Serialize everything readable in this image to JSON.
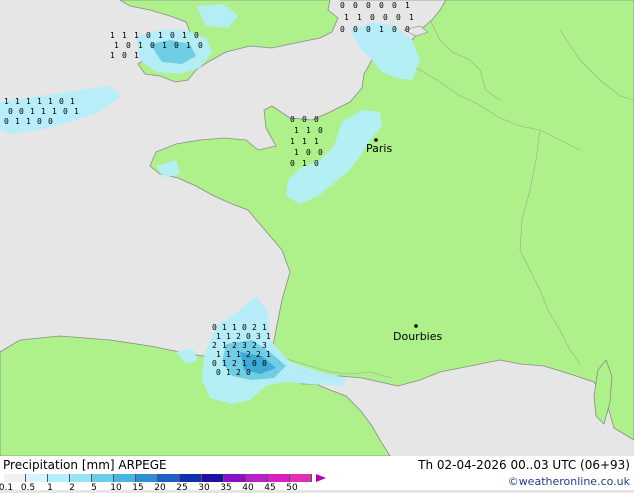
{
  "map": {
    "colors": {
      "land": "#aef08a",
      "sea": "#e6e6e6",
      "coast": "#8a8a8a",
      "precip_light": "#b4eefa",
      "precip_mid": "#6ccde8",
      "precip_heavy": "#38a8d8"
    },
    "cities": [
      {
        "name": "Paris"
      },
      {
        "name": "Dourbies"
      }
    ],
    "grid_values": {
      "channel": [
        "1",
        "1",
        "1",
        "0",
        "1",
        "0",
        "1",
        "0",
        "1",
        "0",
        "1",
        "0",
        "1",
        "0",
        "1",
        "0",
        "1",
        "0",
        "1"
      ],
      "brittany_west": [
        "1",
        "1",
        "1",
        "1",
        "1",
        "0",
        "1",
        "0",
        "0",
        "1",
        "1",
        "1",
        "0",
        "1",
        "0",
        "1",
        "1",
        "0",
        "0"
      ],
      "normandy": [
        "0",
        "0",
        "0",
        "1",
        "1",
        "0",
        "1",
        "1",
        "1",
        "1",
        "0",
        "0",
        "0",
        "1",
        "0"
      ],
      "pyrenees": [
        "0",
        "1",
        "1",
        "0",
        "2",
        "1",
        "1",
        "1",
        "2",
        "0",
        "3",
        "1",
        "2",
        "1",
        "2",
        "3",
        "2",
        "3",
        "1",
        "1",
        "1",
        "2",
        "2",
        "1",
        "0",
        "1",
        "2",
        "1",
        "0",
        "0",
        "0",
        "1",
        "2",
        "0"
      ],
      "benelux": [
        "0",
        "0",
        "0",
        "0",
        "0",
        "1",
        "1",
        "1",
        "0",
        "0",
        "0",
        "1",
        "0",
        "0",
        "0",
        "1",
        "0",
        "0"
      ]
    }
  },
  "footer": {
    "title": "Precipitation [mm]  ARPEGE",
    "valid": "Th 02-04-2026 00..03 UTC (06+93)",
    "credit": "©weatheronline.co.uk",
    "scale": {
      "labels": [
        "0.1",
        "0.5",
        "1",
        "2",
        "5",
        "10",
        "15",
        "20",
        "25",
        "30",
        "35",
        "40",
        "45",
        "50"
      ],
      "colors": [
        "#f2f2f2",
        "#d2f6fc",
        "#b4eefa",
        "#96e4f6",
        "#6ccde8",
        "#48b4e0",
        "#2f8ed4",
        "#1f60c4",
        "#1030b0",
        "#2010a0",
        "#8a10c8",
        "#b820c8",
        "#d820c0",
        "#e030b8"
      ]
    }
  }
}
